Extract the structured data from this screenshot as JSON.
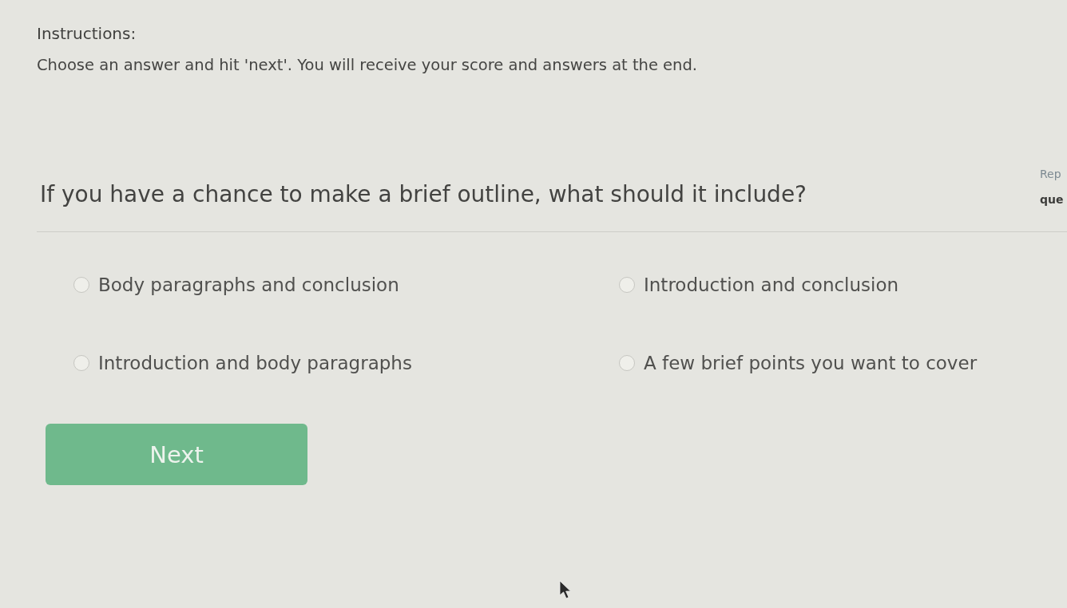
{
  "instructions": {
    "heading": "Instructions:",
    "text": "Choose an answer and hit 'next'. You will receive your score and answers at the end."
  },
  "question": {
    "text": "If you have a chance to make a brief outline, what should it include?"
  },
  "side_panel": {
    "top_text": "Rep",
    "bottom_text": "que"
  },
  "options": [
    {
      "label": "Body paragraphs and conclusion",
      "selected": false
    },
    {
      "label": "Introduction and conclusion",
      "selected": false
    },
    {
      "label": "Introduction and body paragraphs",
      "selected": false
    },
    {
      "label": "A few brief points you want to cover",
      "selected": false
    }
  ],
  "next_button": {
    "label": "Next"
  }
}
